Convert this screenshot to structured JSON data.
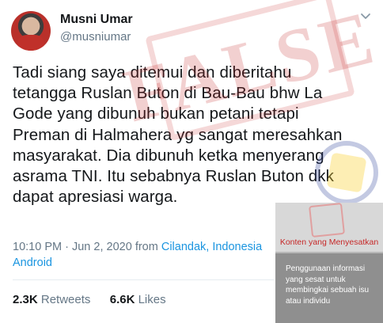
{
  "tweet": {
    "display_name": "Musni Umar",
    "handle": "@musniumar",
    "body_lines": [
      "Tadi siang saya ditemui dan diberitahu",
      "tetangga Ruslan Buton di Bau-Bau bhw La",
      "Gode yang dibunuh bukan petani tetapi",
      "Preman di Halmahera yg sangat meresahkan",
      "masyarakat. Dia dibunuh ketka menyerang",
      "asrama TNI. Itu sebabnya Ruslan Buton dkk",
      "dapat apresiasi warga."
    ],
    "time": "10:10 PM",
    "separator": "·",
    "date": "Jun 2, 2020",
    "from_label": "from",
    "location": "Cilandak, Indonesia",
    "source": "Android",
    "retweets_count": "2.3K",
    "retweets_label": "Retweets",
    "likes_count": "6.6K",
    "likes_label": "Likes"
  },
  "watermark": {
    "stamp_text": "FALSE"
  },
  "overlay": {
    "title": "Konten yang Menyesatkan",
    "description": "Penggunaan informasi yang sesat untuk membingkai sebuah isu atau individu"
  },
  "colors": {
    "link": "#1b95e0",
    "secondary_text": "#657786",
    "stamp_red": "#c62828"
  }
}
